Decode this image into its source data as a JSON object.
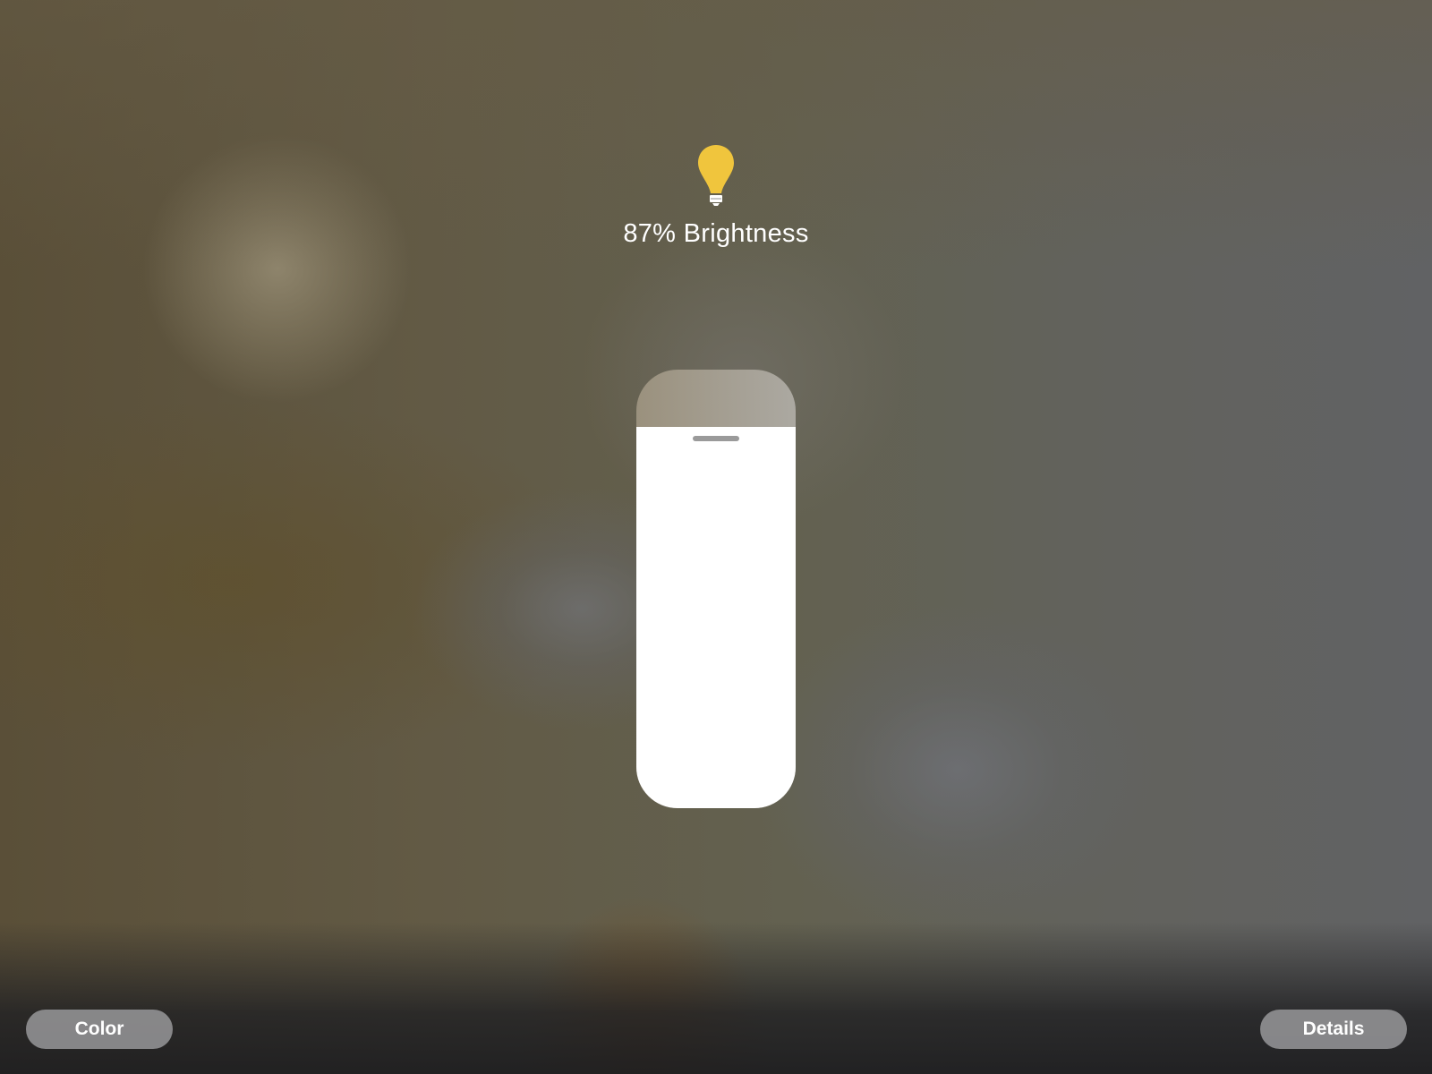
{
  "light": {
    "brightness_percent": 87,
    "title": "87% Brightness",
    "icon": "lightbulb-icon",
    "icon_color": "#f0c53d"
  },
  "buttons": {
    "color_label": "Color",
    "details_label": "Details"
  }
}
